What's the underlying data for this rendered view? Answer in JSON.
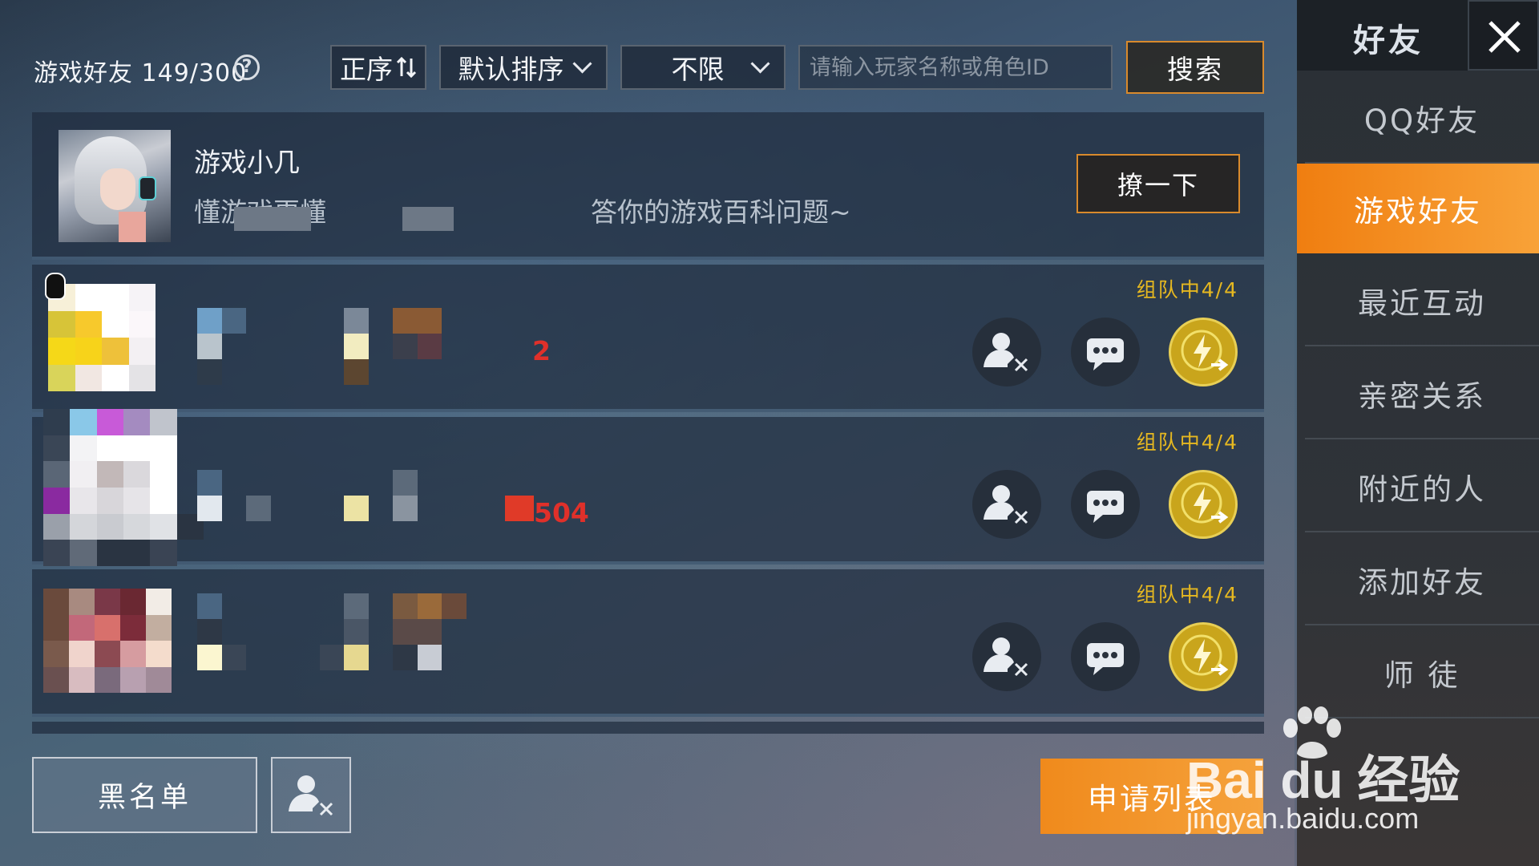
{
  "header": {
    "title": "游戏好友 149/300",
    "help_icon": "question-circle-icon",
    "order_label": "正序",
    "order_icon": "sort-arrows-icon",
    "sort_label": "默认排序",
    "filter_label": "不限",
    "search_placeholder": "请输入玩家名称或角色ID",
    "search_label": "搜索"
  },
  "featured": {
    "name": "游戏小几",
    "desc_start": "懂游戏更懂",
    "desc_end": "答你的游戏百科问题~",
    "action_label": "撩一下"
  },
  "friends": [
    {
      "status": "组队中4/4",
      "suffix": "2"
    },
    {
      "status": "组队中4/4",
      "suffix": "504"
    },
    {
      "status": "组队中4/4",
      "suffix": ""
    }
  ],
  "bottom": {
    "blacklist_label": "黑名单",
    "apply_label": "申请列表"
  },
  "sidebar": {
    "title": "好友",
    "items": [
      {
        "label": "QQ好友",
        "active": false
      },
      {
        "label": "游戏好友",
        "active": true
      },
      {
        "label": "最近互动",
        "active": false
      },
      {
        "label": "亲密关系",
        "active": false
      },
      {
        "label": "附近的人",
        "active": false
      },
      {
        "label": "添加好友",
        "active": false
      },
      {
        "label": "师  徒",
        "active": false
      }
    ]
  },
  "watermark": {
    "brand": "Bai du 经验",
    "url": "jingyan.baidu.com"
  },
  "colors": {
    "accent_orange": "#f08a1c",
    "team_status_yellow": "#e6b820",
    "invite_gold": "#c9a51c"
  }
}
